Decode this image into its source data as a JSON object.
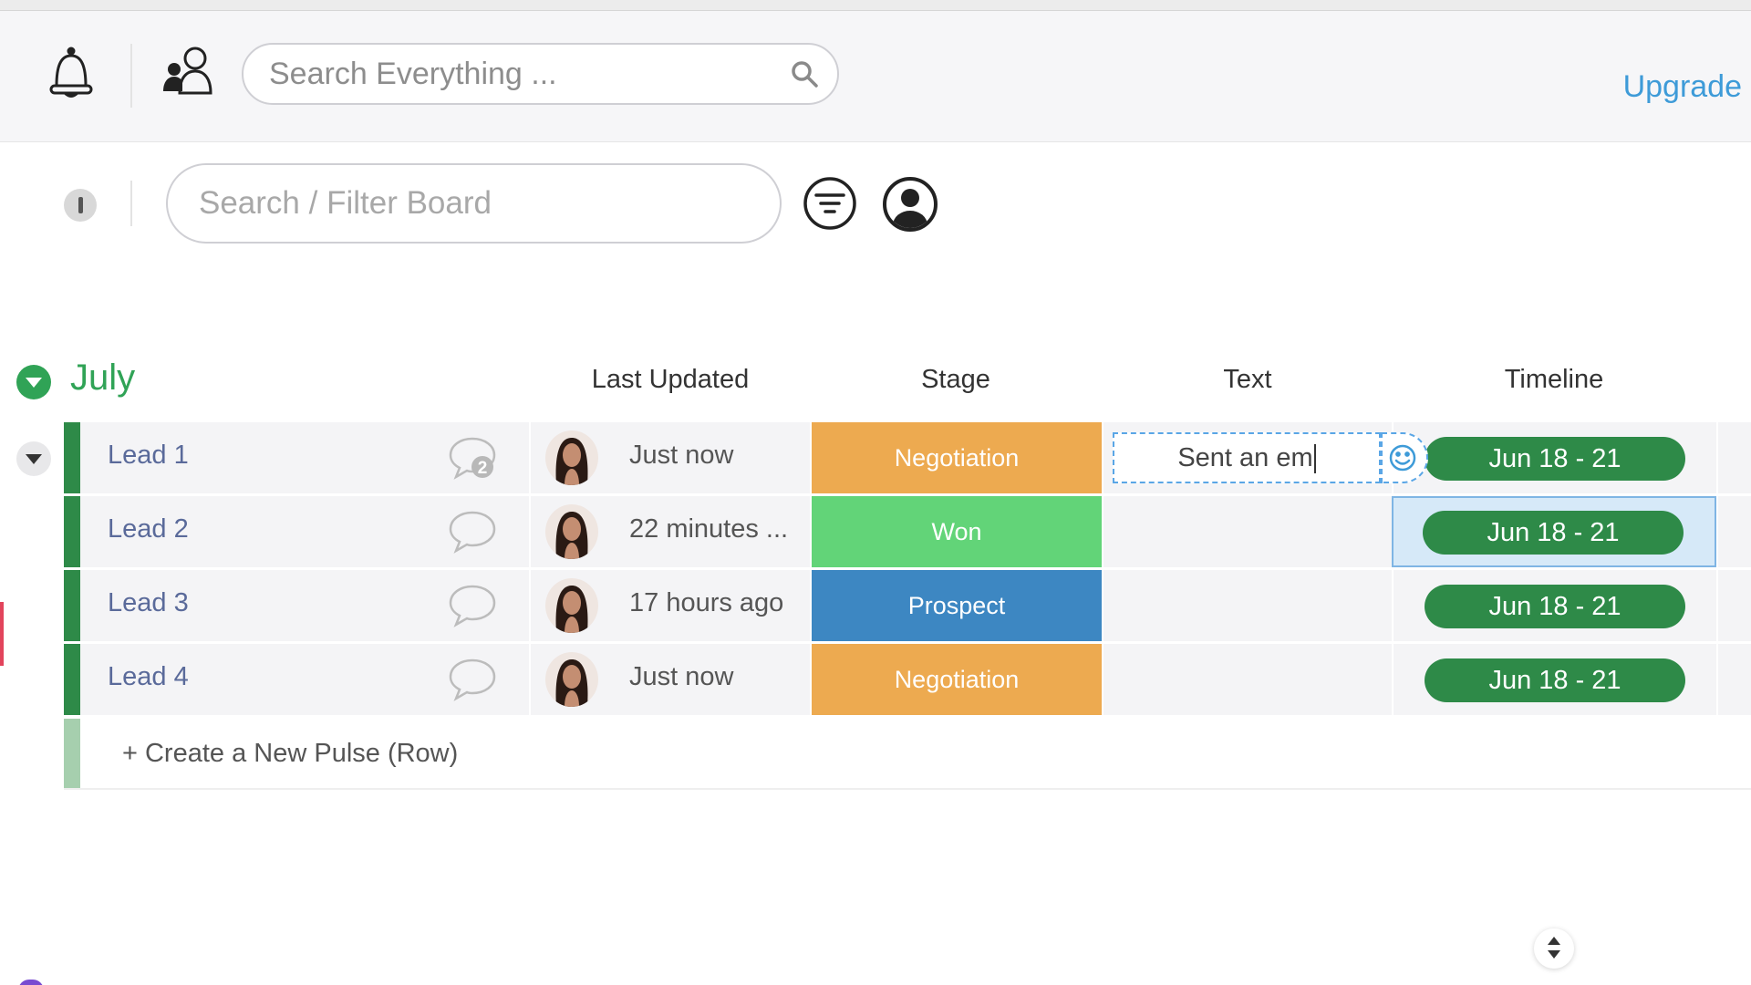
{
  "header": {
    "search_placeholder": "Search Everything ...",
    "upgrade_label": "Upgrade"
  },
  "toolbar": {
    "filter_placeholder": "Search / Filter Board"
  },
  "group": {
    "title": "July",
    "color": "#30a356",
    "columns": {
      "last_updated": "Last Updated",
      "stage": "Stage",
      "text": "Text",
      "timeline": "Timeline"
    }
  },
  "rows": [
    {
      "name": "Lead 1",
      "comments": "2",
      "updated": "Just now",
      "stage": "Negotiation",
      "stage_color": "#edaa50",
      "text": "",
      "timeline": "Jun 18 - 21"
    },
    {
      "name": "Lead 2",
      "comments": "",
      "updated": "22 minutes ...",
      "stage": "Won",
      "stage_color": "#62d478",
      "text": "",
      "timeline": "Jun 18 - 21"
    },
    {
      "name": "Lead 3",
      "comments": "",
      "updated": "17 hours ago",
      "stage": "Prospect",
      "stage_color": "#3d87c2",
      "text": "",
      "timeline": "Jun 18 - 21"
    },
    {
      "name": "Lead 4",
      "comments": "",
      "updated": "Just now",
      "stage": "Negotiation",
      "stage_color": "#edaa50",
      "text": "",
      "timeline": "Jun 18 - 21"
    }
  ],
  "editing": {
    "text_value": "Sent an em"
  },
  "new_row_label": "+ Create a New Pulse (Row)",
  "icons": {
    "notifications": "bell-icon",
    "team": "people-icon",
    "search": "search-icon",
    "filter": "filter-icon",
    "person": "person-icon",
    "comment": "speech-bubble-icon",
    "emoji": "smiley-icon"
  }
}
